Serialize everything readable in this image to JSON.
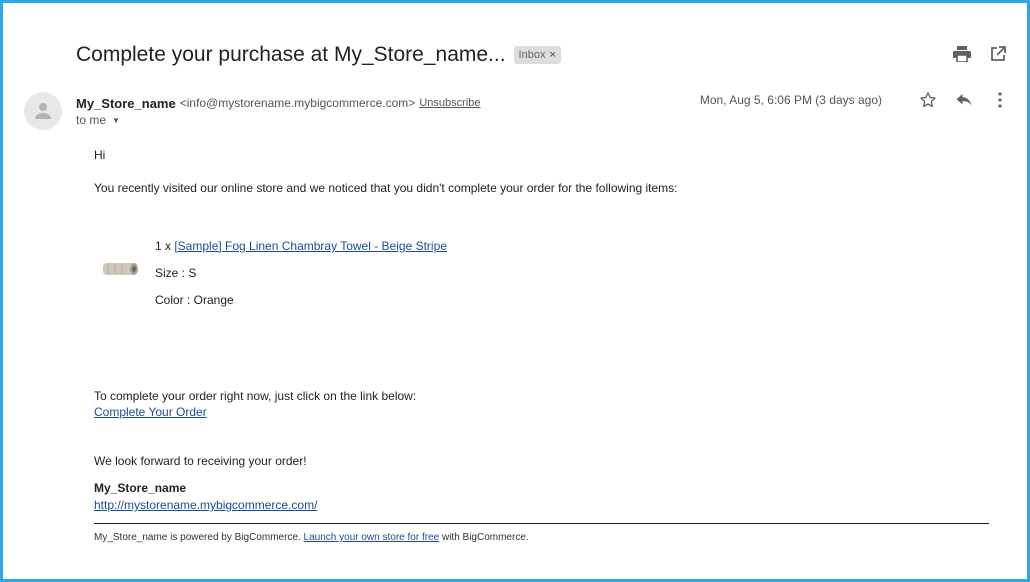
{
  "email": {
    "subject": "Complete your purchase at My_Store_name...",
    "label": "Inbox",
    "label_close": "×",
    "sender_name": "My_Store_name",
    "sender_email": "<info@mystorename.mybigcommerce.com>",
    "unsubscribe": "Unsubscribe",
    "date": "Mon, Aug 5, 6:06 PM (3 days ago)",
    "to": "to me",
    "to_caret": "▼"
  },
  "body": {
    "greeting": "Hi",
    "intro": "You recently visited our online store and we noticed that you didn't complete your order for the following items:",
    "item": {
      "qty_prefix": "1 x ",
      "name": "[Sample] Fog Linen Chambray Towel - Beige Stripe",
      "size": "Size : S",
      "color": "Color : Orange"
    },
    "cta_text": "To complete your order right now, just click on the link below:",
    "cta_link": "Complete Your Order",
    "closing": "We look forward to receiving your order!",
    "signature_name": "My_Store_name",
    "signature_url": "http://mystorename.mybigcommerce.com/"
  },
  "footer": {
    "prefix": "My_Store_name is powered by BigCommerce.",
    "link": "Launch your own store for free",
    "suffix": "with BigCommerce."
  },
  "colors": {
    "frame": "#29abe2",
    "link": "#1a4c9c"
  },
  "icons": [
    "print-icon",
    "open-in-new-icon",
    "avatar-icon",
    "star-icon",
    "reply-icon",
    "more-icon",
    "chevron-down-icon"
  ]
}
